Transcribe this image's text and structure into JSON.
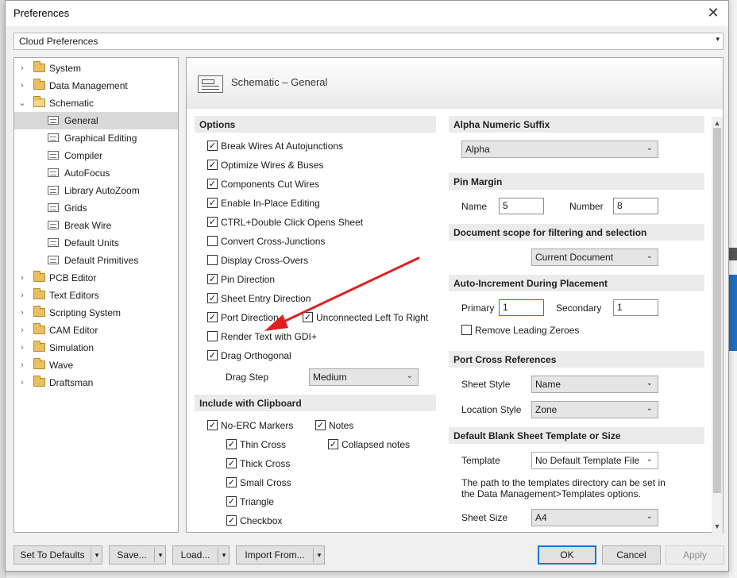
{
  "window": {
    "title": "Preferences",
    "close_glyph": "✕"
  },
  "cloud_combo": {
    "value": "Cloud Preferences"
  },
  "tree": {
    "items": [
      {
        "label": "System",
        "level": 0,
        "icon": "folder-icon",
        "expander": "›"
      },
      {
        "label": "Data Management",
        "level": 0,
        "icon": "folder-icon",
        "expander": "›"
      },
      {
        "label": "Schematic",
        "level": 0,
        "icon": "folder-open-icon",
        "expander": "⌄"
      },
      {
        "label": "General",
        "level": 1,
        "icon": "page-icon",
        "selected": true
      },
      {
        "label": "Graphical Editing",
        "level": 1,
        "icon": "page-icon"
      },
      {
        "label": "Compiler",
        "level": 1,
        "icon": "page-icon"
      },
      {
        "label": "AutoFocus",
        "level": 1,
        "icon": "page-icon"
      },
      {
        "label": "Library AutoZoom",
        "level": 1,
        "icon": "page-icon"
      },
      {
        "label": "Grids",
        "level": 1,
        "icon": "page-icon"
      },
      {
        "label": "Break Wire",
        "level": 1,
        "icon": "page-icon"
      },
      {
        "label": "Default Units",
        "level": 1,
        "icon": "page-icon"
      },
      {
        "label": "Default Primitives",
        "level": 1,
        "icon": "page-icon"
      },
      {
        "label": "PCB Editor",
        "level": 0,
        "icon": "folder-icon",
        "expander": "›"
      },
      {
        "label": "Text Editors",
        "level": 0,
        "icon": "folder-icon",
        "expander": "›"
      },
      {
        "label": "Scripting System",
        "level": 0,
        "icon": "folder-icon",
        "expander": "›"
      },
      {
        "label": "CAM Editor",
        "level": 0,
        "icon": "folder-icon",
        "expander": "›"
      },
      {
        "label": "Simulation",
        "level": 0,
        "icon": "folder-icon",
        "expander": "›"
      },
      {
        "label": "Wave",
        "level": 0,
        "icon": "folder-icon",
        "expander": "›"
      },
      {
        "label": "Draftsman",
        "level": 0,
        "icon": "folder-icon",
        "expander": "›"
      }
    ]
  },
  "page": {
    "title": "Schematic – General"
  },
  "options": {
    "header": "Options",
    "checkboxes": [
      {
        "label": "Break Wires At Autojunctions",
        "checked": true
      },
      {
        "label": "Optimize Wires & Buses",
        "checked": true
      },
      {
        "label": "Components Cut Wires",
        "checked": true
      },
      {
        "label": "Enable In-Place Editing",
        "checked": true
      },
      {
        "label": "CTRL+Double Click Opens Sheet",
        "checked": true
      },
      {
        "label": "Convert Cross-Junctions",
        "checked": false
      },
      {
        "label": "Display Cross-Overs",
        "checked": false
      },
      {
        "label": "Pin Direction",
        "checked": true
      },
      {
        "label": "Sheet Entry Direction",
        "checked": true
      },
      {
        "label": "Port Direction",
        "checked": true
      },
      {
        "label": "Render Text with GDI+",
        "checked": false
      },
      {
        "label": "Drag Orthogonal",
        "checked": true
      }
    ],
    "unconnected": {
      "label": "Unconnected Left To Right",
      "checked": true
    },
    "drag_step": {
      "label": "Drag Step",
      "value": "Medium"
    }
  },
  "clipboard": {
    "header": "Include with Clipboard",
    "no_erc": {
      "label": "No-ERC Markers",
      "checked": true
    },
    "notes": {
      "label": "Notes",
      "checked": true
    },
    "collapsed_notes": {
      "label": "Collapsed notes",
      "checked": true
    },
    "sub": [
      {
        "label": "Thin Cross",
        "checked": true
      },
      {
        "label": "Thick Cross",
        "checked": true
      },
      {
        "label": "Small Cross",
        "checked": true
      },
      {
        "label": "Triangle",
        "checked": true
      },
      {
        "label": "Checkbox",
        "checked": true
      }
    ]
  },
  "alpha_suffix": {
    "header": "Alpha Numeric Suffix",
    "value": "Alpha"
  },
  "pin_margin": {
    "header": "Pin Margin",
    "name_label": "Name",
    "name_value": "5",
    "number_label": "Number",
    "number_value": "8"
  },
  "doc_scope": {
    "header": "Document scope for filtering and selection",
    "value": "Current Document"
  },
  "auto_increment": {
    "header": "Auto-Increment During Placement",
    "primary_label": "Primary",
    "primary_value": "1",
    "secondary_label": "Secondary",
    "secondary_value": "1",
    "remove_zeroes": {
      "label": "Remove Leading Zeroes",
      "checked": false
    }
  },
  "port_cross": {
    "header": "Port Cross References",
    "sheet_style_label": "Sheet Style",
    "sheet_style_value": "Name",
    "location_style_label": "Location Style",
    "location_style_value": "Zone"
  },
  "blank_sheet": {
    "header": "Default Blank Sheet Template or Size",
    "template_label": "Template",
    "template_value": "No Default Template File",
    "path_note": "The path to the templates directory can be set in the Data Management>Templates options.",
    "sheet_size_label": "Sheet Size",
    "sheet_size_value": "A4"
  },
  "footer": {
    "set_defaults": "Set To Defaults",
    "save": "Save...",
    "load": "Load...",
    "import_from": "Import From...",
    "ok": "OK",
    "cancel": "Cancel",
    "apply": "Apply"
  },
  "glyphs": {
    "check": "✓",
    "dropdown": "▾",
    "chevron": "⌄"
  },
  "colors": {
    "annotation_arrow": "#e02020",
    "focus_border": "#2e79c4",
    "ok_border": "#0078d7"
  }
}
